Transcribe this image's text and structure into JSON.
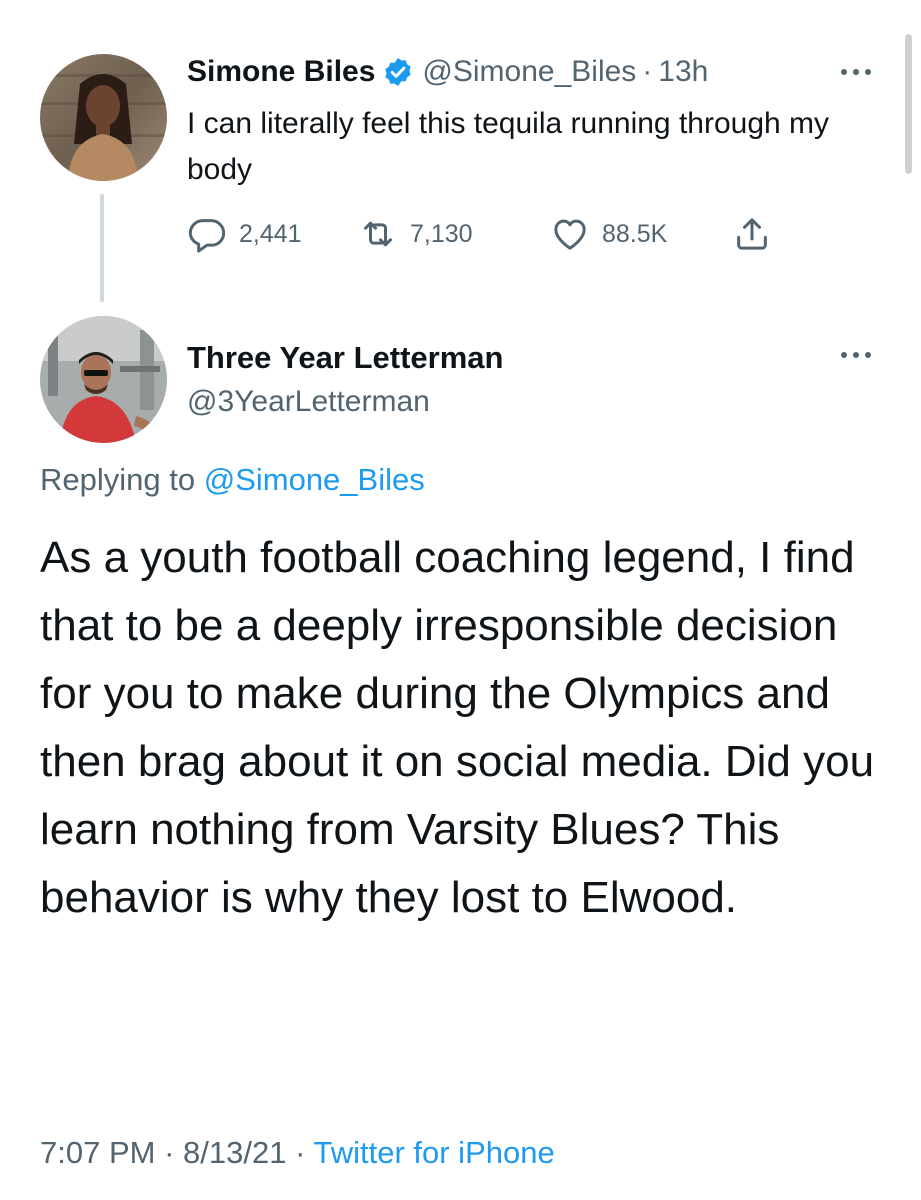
{
  "parent_tweet": {
    "author_name": "Simone Biles",
    "handle": "@Simone_Biles",
    "separator": "·",
    "time_ago": "13h",
    "text": "I can literally feel this tequila running through my body",
    "stats": {
      "replies": "2,441",
      "retweets": "7,130",
      "likes": "88.5K"
    },
    "verified": true
  },
  "reply_tweet": {
    "author_name": "Three Year Letterman",
    "handle": "@3YearLetterman",
    "replying_prefix": "Replying to",
    "replying_handle": "@Simone_Biles",
    "text": "As a youth football coaching legend, I find that to be a deeply irresponsible decision for you to make during the Olympics and then brag about it on social media. Did you learn nothing from Varsity Blues? This behavior is why they lost to Elwood.",
    "time": "7:07 PM",
    "date": "8/13/21",
    "separator": "·",
    "source": "Twitter for iPhone"
  },
  "icons": {
    "verified": "verified-badge-icon",
    "more": "more-options-icon",
    "reply": "reply-icon",
    "retweet": "retweet-icon",
    "like": "heart-icon",
    "share": "share-icon"
  },
  "colors": {
    "text": "#0f1419",
    "muted": "#536471",
    "link": "#1d9bf0",
    "thread_line": "#cfd9de"
  }
}
